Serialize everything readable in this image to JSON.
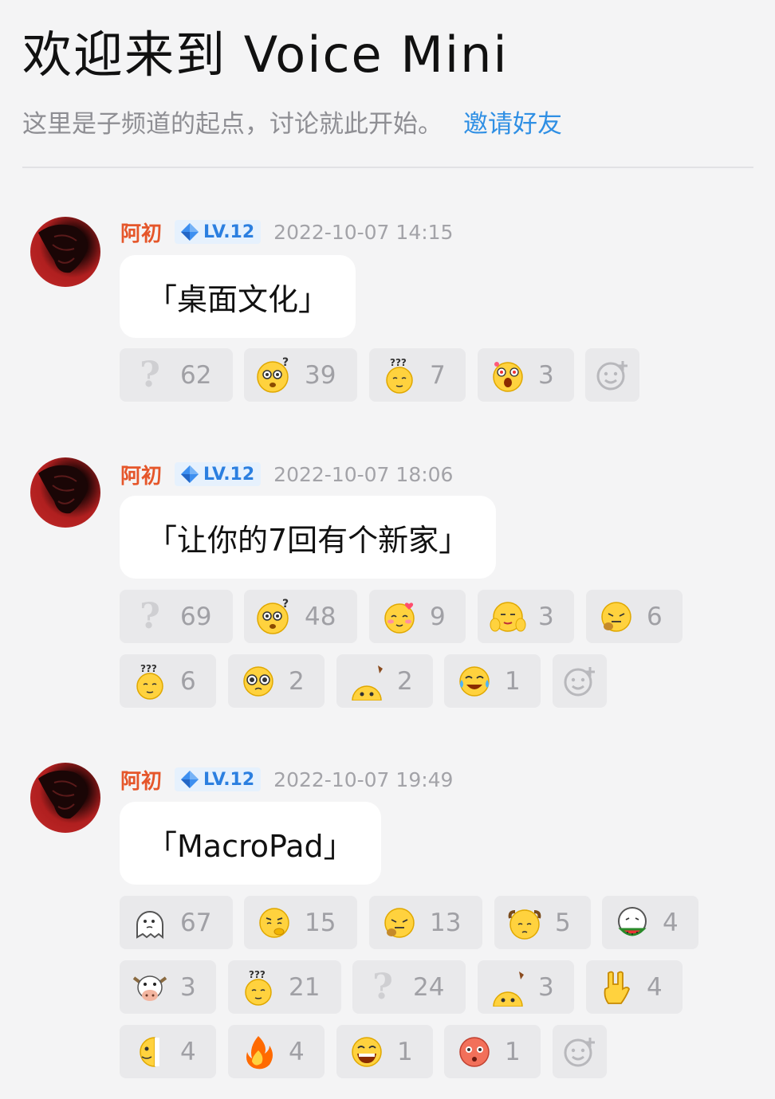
{
  "header": {
    "title": "欢迎来到 Voice Mini",
    "subtitle": "这里是子频道的起点，讨论就此开始。",
    "invite_label": "邀请好友"
  },
  "messages": [
    {
      "username": "阿初",
      "level": "LV.12",
      "timestamp": "2022-10-07 14:15",
      "text": "「桌面文化」",
      "reactions": [
        {
          "icon": "question-mark-icon",
          "count": "62"
        },
        {
          "icon": "puzzled-face-icon",
          "count": "39"
        },
        {
          "icon": "confused-question-face-icon",
          "count": "7"
        },
        {
          "icon": "shocked-face-icon",
          "count": "3"
        }
      ]
    },
    {
      "username": "阿初",
      "level": "LV.12",
      "timestamp": "2022-10-07 18:06",
      "text": "「让你的7回有个新家」",
      "reactions": [
        {
          "icon": "question-mark-icon",
          "count": "69"
        },
        {
          "icon": "puzzled-face-icon",
          "count": "48"
        },
        {
          "icon": "shy-face-icon",
          "count": "9"
        },
        {
          "icon": "facepalm-face-icon",
          "count": "3"
        },
        {
          "icon": "yawn-face-icon",
          "count": "6"
        },
        {
          "icon": "confused-question-face-icon",
          "count": "6"
        },
        {
          "icon": "teary-eyes-face-icon",
          "count": "2"
        },
        {
          "icon": "peeking-face-icon",
          "count": "2"
        },
        {
          "icon": "tears-of-joy-icon",
          "count": "1"
        }
      ]
    },
    {
      "username": "阿初",
      "level": "LV.12",
      "timestamp": "2022-10-07 19:49",
      "text": "「MacroPad」",
      "reactions": [
        {
          "icon": "thinking-ghost-icon",
          "count": "67"
        },
        {
          "icon": "pondering-face-icon",
          "count": "15"
        },
        {
          "icon": "yawn-face-icon",
          "count": "13"
        },
        {
          "icon": "bald-face-icon",
          "count": "5"
        },
        {
          "icon": "watermelon-face-icon",
          "count": "4"
        },
        {
          "icon": "cow-face-icon",
          "count": "3"
        },
        {
          "icon": "confused-question-face-icon",
          "count": "21"
        },
        {
          "icon": "question-mark-icon",
          "count": "24"
        },
        {
          "icon": "peeking-face-icon",
          "count": "3"
        },
        {
          "icon": "rock-hand-icon",
          "count": "4"
        },
        {
          "icon": "half-face-icon",
          "count": "4"
        },
        {
          "icon": "fire-icon",
          "count": "4"
        },
        {
          "icon": "grinning-face-icon",
          "count": "1"
        },
        {
          "icon": "blushing-red-face-icon",
          "count": "1"
        }
      ]
    }
  ]
}
